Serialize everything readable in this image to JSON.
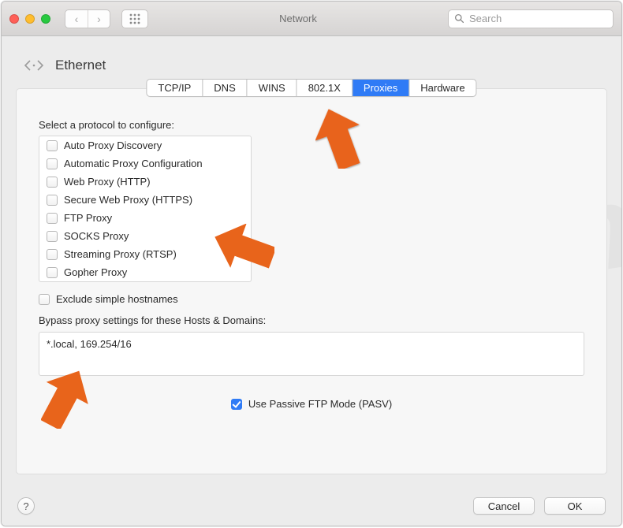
{
  "window": {
    "title": "Network",
    "search_placeholder": "Search"
  },
  "header": {
    "title": "Ethernet"
  },
  "tabs": [
    {
      "label": "TCP/IP",
      "selected": false
    },
    {
      "label": "DNS",
      "selected": false
    },
    {
      "label": "WINS",
      "selected": false
    },
    {
      "label": "802.1X",
      "selected": false
    },
    {
      "label": "Proxies",
      "selected": true
    },
    {
      "label": "Hardware",
      "selected": false
    }
  ],
  "protocols": {
    "label": "Select a protocol to configure:",
    "items": [
      {
        "label": "Auto Proxy Discovery",
        "checked": false
      },
      {
        "label": "Automatic Proxy Configuration",
        "checked": false
      },
      {
        "label": "Web Proxy (HTTP)",
        "checked": false
      },
      {
        "label": "Secure Web Proxy (HTTPS)",
        "checked": false
      },
      {
        "label": "FTP Proxy",
        "checked": false
      },
      {
        "label": "SOCKS Proxy",
        "checked": false
      },
      {
        "label": "Streaming Proxy (RTSP)",
        "checked": false
      },
      {
        "label": "Gopher Proxy",
        "checked": false
      }
    ]
  },
  "exclude": {
    "label": "Exclude simple hostnames",
    "checked": false
  },
  "bypass": {
    "label": "Bypass proxy settings for these Hosts & Domains:",
    "value": "*.local, 169.254/16"
  },
  "pasv": {
    "label": "Use Passive FTP Mode (PASV)",
    "checked": true
  },
  "buttons": {
    "help": "?",
    "cancel": "Cancel",
    "ok": "OK"
  },
  "icons": {
    "back": "‹",
    "forward": "›",
    "search": "search"
  },
  "watermark": "PCrisk.com"
}
